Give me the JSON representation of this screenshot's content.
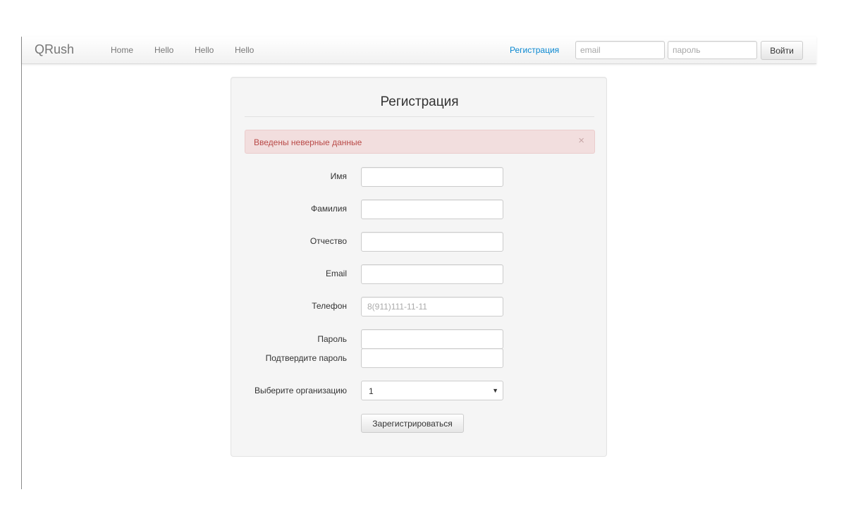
{
  "navbar": {
    "brand": "QRush",
    "links": [
      "Home",
      "Hello",
      "Hello",
      "Hello"
    ],
    "register_link": "Регистрация",
    "email_placeholder": "email",
    "password_placeholder": "пароль",
    "login_button": "Войти"
  },
  "form": {
    "title": "Регистрация",
    "alert_text": "Введены неверные данные",
    "alert_close": "×",
    "fields": [
      {
        "label": "Имя",
        "value": "",
        "placeholder": ""
      },
      {
        "label": "Фамилия",
        "value": "",
        "placeholder": ""
      },
      {
        "label": "Отчество",
        "value": "",
        "placeholder": ""
      },
      {
        "label": "Email",
        "value": "",
        "placeholder": ""
      },
      {
        "label": "Телефон",
        "value": "",
        "placeholder": "8(911)111-11-11"
      },
      {
        "label": "Пароль",
        "value": "",
        "placeholder": ""
      },
      {
        "label": "Подтвердите пароль",
        "value": "",
        "placeholder": ""
      }
    ],
    "organization": {
      "label": "Выберите организацию",
      "selected": "1",
      "arrow": "▼"
    },
    "submit_button": "Зарегистрироваться"
  },
  "colors": {
    "link_blue": "#0a88d1",
    "alert_bg": "#f2dede",
    "alert_text": "#b94a48",
    "panel_bg": "#f5f5f5"
  }
}
